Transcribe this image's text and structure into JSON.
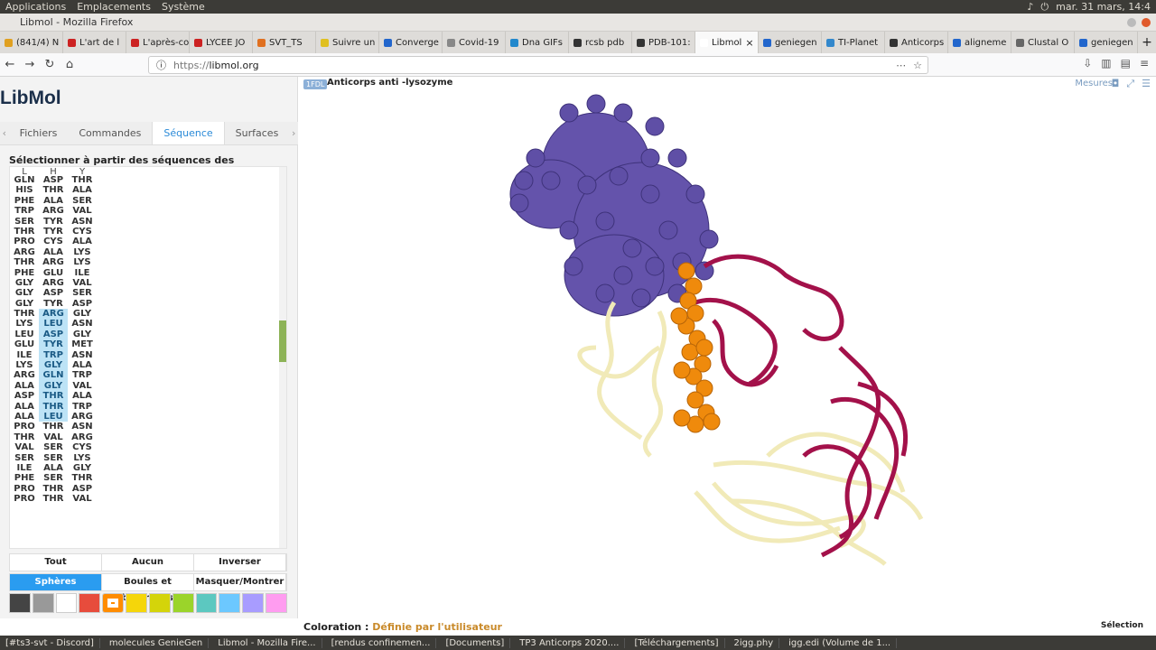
{
  "system": {
    "menus": [
      "Applications",
      "Emplacements",
      "Système"
    ],
    "clock": "mar. 31 mars, 14:4"
  },
  "window": {
    "title": "Libmol - Mozilla Firefox"
  },
  "tabs": [
    {
      "label": "(841/4) N",
      "color": "#e0a020"
    },
    {
      "label": "L'art de l",
      "color": "#cc2222"
    },
    {
      "label": "L'après-co",
      "color": "#cc2222"
    },
    {
      "label": "LYCEE JO",
      "color": "#cc2222"
    },
    {
      "label": "SVT_TS",
      "color": "#e07020"
    },
    {
      "label": "Suivre un",
      "color": "#e0c020"
    },
    {
      "label": "Converge",
      "color": "#2266cc"
    },
    {
      "label": "Covid-19",
      "color": "#888888"
    },
    {
      "label": "Dna GIFs",
      "color": "#2288cc"
    },
    {
      "label": "rcsb pdb",
      "color": "#333333"
    },
    {
      "label": "PDB-101:",
      "color": "#333333"
    },
    {
      "label": "Libmol",
      "color": "#ffffff",
      "active": true
    },
    {
      "label": "geniegen",
      "color": "#2266cc"
    },
    {
      "label": "TI-Planet",
      "color": "#3388cc"
    },
    {
      "label": "Anticorps",
      "color": "#333333"
    },
    {
      "label": "aligneme",
      "color": "#2266cc"
    },
    {
      "label": "Clustal O",
      "color": "#666666"
    },
    {
      "label": "geniegen",
      "color": "#2266cc"
    }
  ],
  "nav": {
    "url_proto": "https://",
    "url_host": "libmol.org"
  },
  "app": {
    "logo": "LibMol",
    "panel_tabs": [
      "Fichiers",
      "Commandes",
      "Séquence",
      "Surfaces"
    ],
    "active_tab": "Séquence",
    "seq_title": "Sélectionner à partir des séquences des différentes chaînes",
    "chains": [
      "L",
      "H",
      "Y"
    ],
    "rows": [
      [
        "GLN",
        "ASP",
        "THR"
      ],
      [
        "HIS",
        "THR",
        "ALA"
      ],
      [
        "PHE",
        "ALA",
        "SER"
      ],
      [
        "TRP",
        "ARG",
        "VAL"
      ],
      [
        "SER",
        "TYR",
        "ASN"
      ],
      [
        "THR",
        "TYR",
        "CYS"
      ],
      [
        "PRO",
        "CYS",
        "ALA"
      ],
      [
        "ARG",
        "ALA",
        "LYS"
      ],
      [
        "THR",
        "ARG",
        "LYS"
      ],
      [
        "PHE",
        "GLU",
        "ILE"
      ],
      [
        "GLY",
        "ARG",
        "VAL"
      ],
      [
        "GLY",
        "ASP",
        "SER"
      ],
      [
        "GLY",
        "TYR",
        "ASP"
      ],
      [
        "THR",
        "ARG",
        "GLY"
      ],
      [
        "LYS",
        "LEU",
        "ASN"
      ],
      [
        "LEU",
        "ASP",
        "GLY"
      ],
      [
        "GLU",
        "TYR",
        "MET"
      ],
      [
        "ILE",
        "TRP",
        "ASN"
      ],
      [
        "LYS",
        "GLY",
        "ALA"
      ],
      [
        "ARG",
        "GLN",
        "TRP"
      ],
      [
        "ALA",
        "GLY",
        "VAL"
      ],
      [
        "ASP",
        "THR",
        "ALA"
      ],
      [
        "ALA",
        "THR",
        "TRP"
      ],
      [
        "ALA",
        "LEU",
        "ARG"
      ],
      [
        "PRO",
        "THR",
        "ASN"
      ],
      [
        "THR",
        "VAL",
        "ARG"
      ],
      [
        "VAL",
        "SER",
        "CYS"
      ],
      [
        "SER",
        "SER",
        "LYS"
      ],
      [
        "ILE",
        "ALA",
        "GLY"
      ],
      [
        "PHE",
        "SER",
        "THR"
      ],
      [
        "PRO",
        "THR",
        "ASP"
      ],
      [
        "PRO",
        "THR",
        "VAL"
      ]
    ],
    "highlight_rows_H": [
      13,
      14,
      15,
      16,
      17,
      18,
      19,
      20,
      21,
      22,
      23
    ],
    "select_buttons": [
      "Tout",
      "Aucun",
      "Inverser"
    ],
    "render_buttons": [
      "Sphères",
      "Boules et bâtonnets",
      "Masquer/Montrer"
    ],
    "swatches": [
      "#444444",
      "#999999",
      "#ffffff",
      "#e74c3c",
      "#ff8c00",
      "#f5d60a",
      "#d4d40a",
      "#9bd42a",
      "#5cc8c0",
      "#6cc8ff",
      "#a89cff",
      "#ff9cf0"
    ],
    "mol_badge": "1FDL",
    "mol_name": "Anticorps anti -lysozyme",
    "mesures": "Mesures",
    "coloration_label": "Coloration : ",
    "coloration_value": "Définie par l'utilisateur",
    "selection": "Sélection"
  },
  "taskbar": [
    "[#ts3-svt - Discord]",
    "molecules GenieGen",
    "Libmol - Mozilla Fire...",
    "[rendus confinemen...",
    "[Documents]",
    "TP3 Anticorps 2020....",
    "[Téléchargements]",
    "2igg.phy",
    "igg.edi (Volume de 1..."
  ]
}
